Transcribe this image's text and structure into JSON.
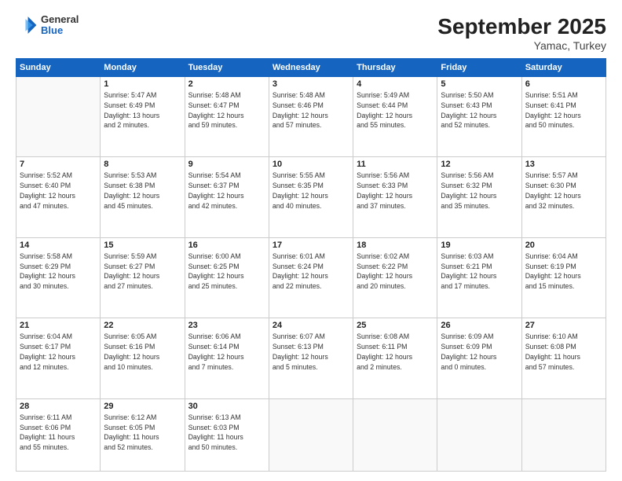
{
  "header": {
    "logo": {
      "line1": "General",
      "line2": "Blue"
    },
    "title": "September 2025",
    "location": "Yamac, Turkey"
  },
  "weekdays": [
    "Sunday",
    "Monday",
    "Tuesday",
    "Wednesday",
    "Thursday",
    "Friday",
    "Saturday"
  ],
  "weeks": [
    [
      {
        "day": "",
        "info": ""
      },
      {
        "day": "1",
        "info": "Sunrise: 5:47 AM\nSunset: 6:49 PM\nDaylight: 13 hours\nand 2 minutes."
      },
      {
        "day": "2",
        "info": "Sunrise: 5:48 AM\nSunset: 6:47 PM\nDaylight: 12 hours\nand 59 minutes."
      },
      {
        "day": "3",
        "info": "Sunrise: 5:48 AM\nSunset: 6:46 PM\nDaylight: 12 hours\nand 57 minutes."
      },
      {
        "day": "4",
        "info": "Sunrise: 5:49 AM\nSunset: 6:44 PM\nDaylight: 12 hours\nand 55 minutes."
      },
      {
        "day": "5",
        "info": "Sunrise: 5:50 AM\nSunset: 6:43 PM\nDaylight: 12 hours\nand 52 minutes."
      },
      {
        "day": "6",
        "info": "Sunrise: 5:51 AM\nSunset: 6:41 PM\nDaylight: 12 hours\nand 50 minutes."
      }
    ],
    [
      {
        "day": "7",
        "info": "Sunrise: 5:52 AM\nSunset: 6:40 PM\nDaylight: 12 hours\nand 47 minutes."
      },
      {
        "day": "8",
        "info": "Sunrise: 5:53 AM\nSunset: 6:38 PM\nDaylight: 12 hours\nand 45 minutes."
      },
      {
        "day": "9",
        "info": "Sunrise: 5:54 AM\nSunset: 6:37 PM\nDaylight: 12 hours\nand 42 minutes."
      },
      {
        "day": "10",
        "info": "Sunrise: 5:55 AM\nSunset: 6:35 PM\nDaylight: 12 hours\nand 40 minutes."
      },
      {
        "day": "11",
        "info": "Sunrise: 5:56 AM\nSunset: 6:33 PM\nDaylight: 12 hours\nand 37 minutes."
      },
      {
        "day": "12",
        "info": "Sunrise: 5:56 AM\nSunset: 6:32 PM\nDaylight: 12 hours\nand 35 minutes."
      },
      {
        "day": "13",
        "info": "Sunrise: 5:57 AM\nSunset: 6:30 PM\nDaylight: 12 hours\nand 32 minutes."
      }
    ],
    [
      {
        "day": "14",
        "info": "Sunrise: 5:58 AM\nSunset: 6:29 PM\nDaylight: 12 hours\nand 30 minutes."
      },
      {
        "day": "15",
        "info": "Sunrise: 5:59 AM\nSunset: 6:27 PM\nDaylight: 12 hours\nand 27 minutes."
      },
      {
        "day": "16",
        "info": "Sunrise: 6:00 AM\nSunset: 6:25 PM\nDaylight: 12 hours\nand 25 minutes."
      },
      {
        "day": "17",
        "info": "Sunrise: 6:01 AM\nSunset: 6:24 PM\nDaylight: 12 hours\nand 22 minutes."
      },
      {
        "day": "18",
        "info": "Sunrise: 6:02 AM\nSunset: 6:22 PM\nDaylight: 12 hours\nand 20 minutes."
      },
      {
        "day": "19",
        "info": "Sunrise: 6:03 AM\nSunset: 6:21 PM\nDaylight: 12 hours\nand 17 minutes."
      },
      {
        "day": "20",
        "info": "Sunrise: 6:04 AM\nSunset: 6:19 PM\nDaylight: 12 hours\nand 15 minutes."
      }
    ],
    [
      {
        "day": "21",
        "info": "Sunrise: 6:04 AM\nSunset: 6:17 PM\nDaylight: 12 hours\nand 12 minutes."
      },
      {
        "day": "22",
        "info": "Sunrise: 6:05 AM\nSunset: 6:16 PM\nDaylight: 12 hours\nand 10 minutes."
      },
      {
        "day": "23",
        "info": "Sunrise: 6:06 AM\nSunset: 6:14 PM\nDaylight: 12 hours\nand 7 minutes."
      },
      {
        "day": "24",
        "info": "Sunrise: 6:07 AM\nSunset: 6:13 PM\nDaylight: 12 hours\nand 5 minutes."
      },
      {
        "day": "25",
        "info": "Sunrise: 6:08 AM\nSunset: 6:11 PM\nDaylight: 12 hours\nand 2 minutes."
      },
      {
        "day": "26",
        "info": "Sunrise: 6:09 AM\nSunset: 6:09 PM\nDaylight: 12 hours\nand 0 minutes."
      },
      {
        "day": "27",
        "info": "Sunrise: 6:10 AM\nSunset: 6:08 PM\nDaylight: 11 hours\nand 57 minutes."
      }
    ],
    [
      {
        "day": "28",
        "info": "Sunrise: 6:11 AM\nSunset: 6:06 PM\nDaylight: 11 hours\nand 55 minutes."
      },
      {
        "day": "29",
        "info": "Sunrise: 6:12 AM\nSunset: 6:05 PM\nDaylight: 11 hours\nand 52 minutes."
      },
      {
        "day": "30",
        "info": "Sunrise: 6:13 AM\nSunset: 6:03 PM\nDaylight: 11 hours\nand 50 minutes."
      },
      {
        "day": "",
        "info": ""
      },
      {
        "day": "",
        "info": ""
      },
      {
        "day": "",
        "info": ""
      },
      {
        "day": "",
        "info": ""
      }
    ]
  ]
}
